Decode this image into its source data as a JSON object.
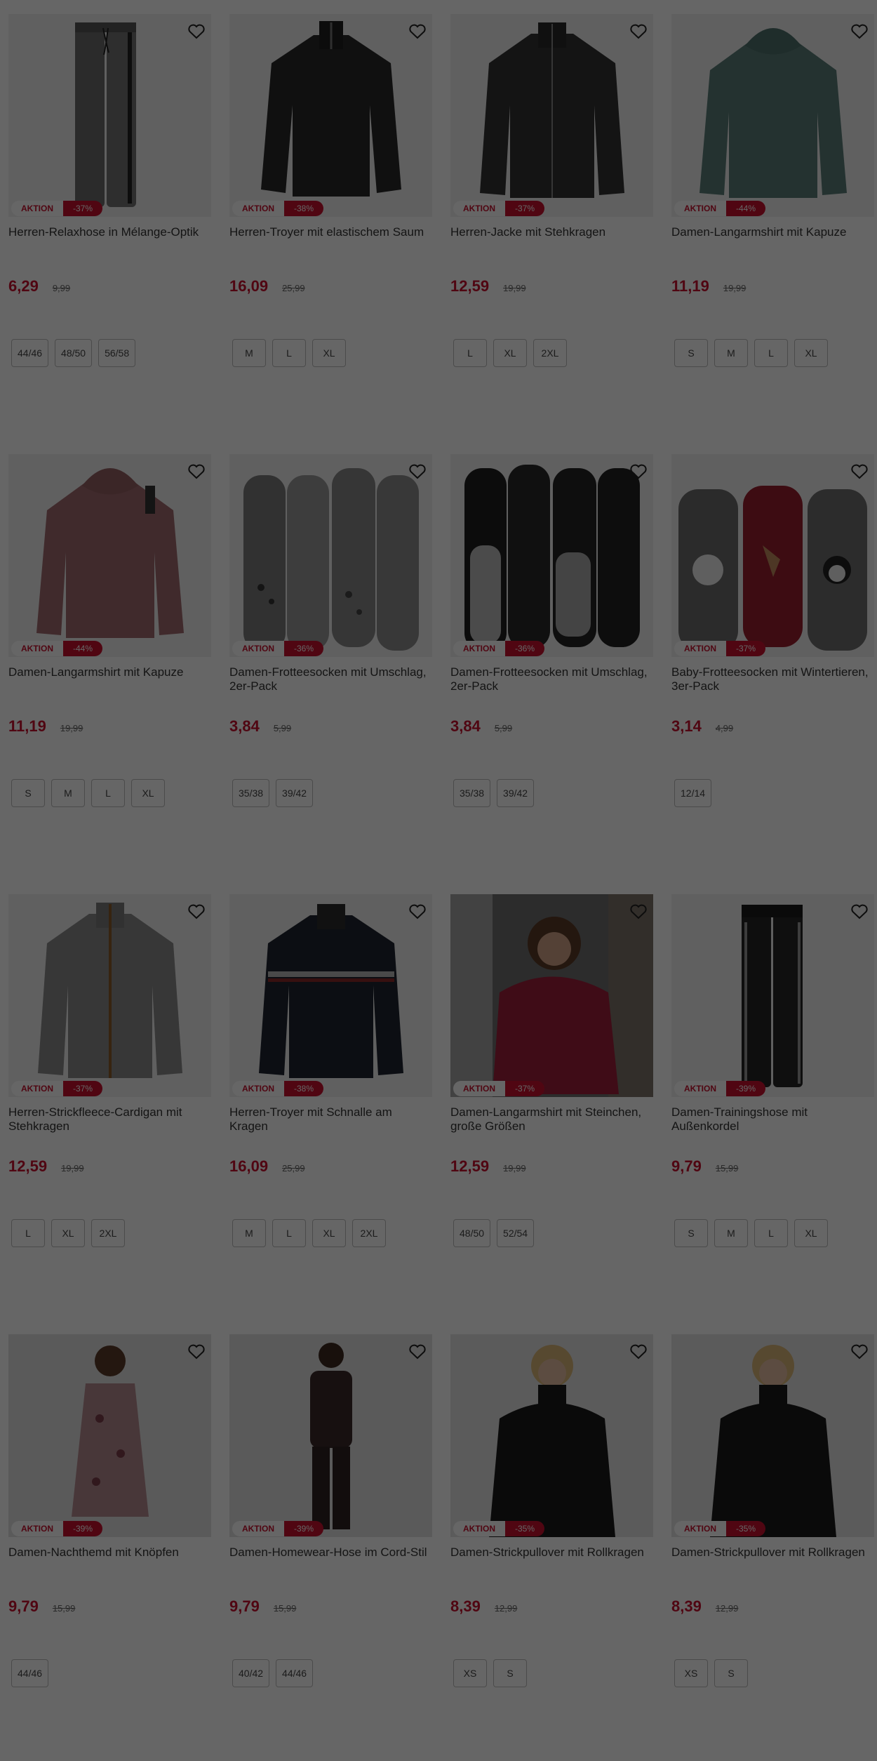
{
  "products": [
    {
      "name": "Herren-Relaxhose in Mélange-Optik",
      "aktion": "AKTION",
      "discount": "-37%",
      "price": "6,29",
      "old_price": "9,99",
      "sizes": [
        "44/46",
        "48/50",
        "56/58"
      ],
      "image": "grey-trousers"
    },
    {
      "name": "Herren-Troyer mit elastischem Saum",
      "aktion": "AKTION",
      "discount": "-38%",
      "price": "16,09",
      "old_price": "25,99",
      "sizes": [
        "M",
        "L",
        "XL"
      ],
      "image": "black-troyer"
    },
    {
      "name": "Herren-Jacke mit Stehkragen",
      "aktion": "AKTION",
      "discount": "-37%",
      "price": "12,59",
      "old_price": "19,99",
      "sizes": [
        "L",
        "XL",
        "2XL"
      ],
      "image": "black-jacket"
    },
    {
      "name": "Damen-Langarmshirt mit Kapuze",
      "aktion": "AKTION",
      "discount": "-44%",
      "price": "11,19",
      "old_price": "19,99",
      "sizes": [
        "S",
        "M",
        "L",
        "XL"
      ],
      "image": "teal-hoodie"
    },
    {
      "name": "Damen-Langarmshirt mit Kapuze",
      "aktion": "AKTION",
      "discount": "-44%",
      "price": "11,19",
      "old_price": "19,99",
      "sizes": [
        "S",
        "M",
        "L",
        "XL"
      ],
      "image": "red-hoodie"
    },
    {
      "name": "Damen-Frotteesocken mit Umschlag, 2er-Pack",
      "aktion": "AKTION",
      "discount": "-36%",
      "price": "3,84",
      "old_price": "5,99",
      "sizes": [
        "35/38",
        "39/42"
      ],
      "image": "grey-socks"
    },
    {
      "name": "Damen-Frotteesocken mit Umschlag, 2er-Pack",
      "aktion": "AKTION",
      "discount": "-36%",
      "price": "3,84",
      "old_price": "5,99",
      "sizes": [
        "35/38",
        "39/42"
      ],
      "image": "black-socks"
    },
    {
      "name": "Baby-Frotteesocken mit Wintertieren, 3er-Pack",
      "aktion": "AKTION",
      "discount": "-37%",
      "price": "3,14",
      "old_price": "4,99",
      "sizes": [
        "12/14"
      ],
      "image": "baby-socks"
    },
    {
      "name": "Herren-Strickfleece-Cardigan mit Stehkragen",
      "aktion": "AKTION",
      "discount": "-37%",
      "price": "12,59",
      "old_price": "19,99",
      "sizes": [
        "L",
        "XL",
        "2XL"
      ],
      "image": "grey-cardigan"
    },
    {
      "name": "Herren-Troyer mit Schnalle am Kragen",
      "aktion": "AKTION",
      "discount": "-38%",
      "price": "16,09",
      "old_price": "25,99",
      "sizes": [
        "M",
        "L",
        "XL",
        "2XL"
      ],
      "image": "navy-troyer"
    },
    {
      "name": "Damen-Langarmshirt mit Steinchen, große Größen",
      "aktion": "AKTION",
      "discount": "-37%",
      "price": "12,59",
      "old_price": "19,99",
      "sizes": [
        "48/50",
        "52/54"
      ],
      "image": "red-shirt-model"
    },
    {
      "name": "Damen-Trainingshose mit Außenkordel",
      "aktion": "AKTION",
      "discount": "-39%",
      "price": "9,79",
      "old_price": "15,99",
      "sizes": [
        "S",
        "M",
        "L",
        "XL"
      ],
      "image": "black-trackpants"
    },
    {
      "name": "Damen-Nachthemd mit Knöpfen",
      "aktion": "AKTION",
      "discount": "-39%",
      "price": "9,79",
      "old_price": "15,99",
      "sizes": [
        "44/46"
      ],
      "image": "floral-nightgown"
    },
    {
      "name": "Damen-Homewear-Hose im Cord-Stil",
      "aktion": "AKTION",
      "discount": "-39%",
      "price": "9,79",
      "old_price": "15,99",
      "sizes": [
        "40/42",
        "44/46"
      ],
      "image": "brown-homewear"
    },
    {
      "name": "Damen-Strickpullover mit Rollkragen",
      "aktion": "AKTION",
      "discount": "-35%",
      "price": "8,39",
      "old_price": "12,99",
      "sizes": [
        "XS",
        "S"
      ],
      "image": "black-turtleneck"
    },
    {
      "name": "Damen-Strickpullover mit Rollkragen",
      "aktion": "AKTION",
      "discount": "-35%",
      "price": "8,39",
      "old_price": "12,99",
      "sizes": [
        "XS",
        "S"
      ],
      "image": "black-turtleneck"
    }
  ],
  "colors": {
    "accent": "#c8102e",
    "overlay": "rgba(0,0,0,0.6)",
    "image_bg": "#f0f0f0"
  },
  "icons": {
    "wishlist": "heart-outline-icon"
  }
}
